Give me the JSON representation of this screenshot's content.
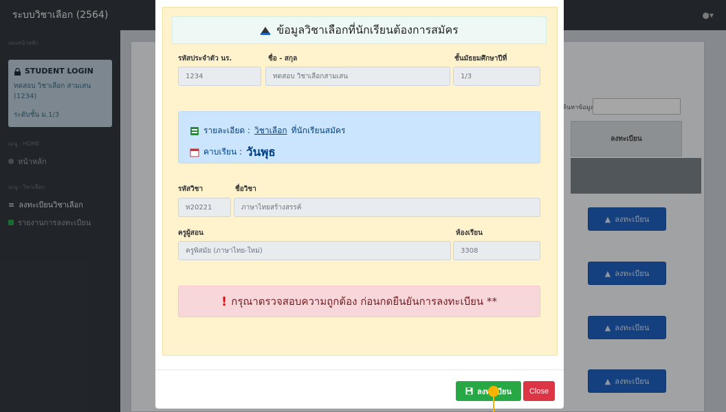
{
  "navbar": {
    "brand": "ระบบวิชาเลือก (2564)",
    "user_icon": "user-icon"
  },
  "sidebar": {
    "menu_head": "เมนหน้าหลัก",
    "login": {
      "title": "STUDENT LOGIN",
      "name": "ทดสอบ วิชาเลือก สามเสน (1234)",
      "level": "ระดับชั้น ม.1/3"
    },
    "section_home": "เมนู : HOME",
    "item_home": "หน้าหลัก",
    "section_subject": "เมนู : วิชาเลือก",
    "item_register": "ลงทะเบียนวิชาเลือก",
    "item_report": "รายงานการลงทะเบียน"
  },
  "background": {
    "search_label": "ค้นหาข้อมูล :",
    "column_header": "ลงทะเบียน",
    "register_buttons": [
      "ลงทะเบียน",
      "ลงทะเบียน",
      "ลงทะเบียน",
      "ลงทะเบียน"
    ]
  },
  "modal": {
    "title": "ข้อมูลวิชาเลือกที่นักเรียนต้องการสมัคร",
    "student_id_label": "รหัสประจำตัว นร.",
    "student_id": "1234",
    "name_label": "ชื่อ - สกุล",
    "name": "ทดสอบ วิชาเลือกสามเสน",
    "grade_label": "ชั้นมัธยมศึกษาปีที่",
    "grade": "1/3",
    "info_prefix": "รายละเอียด :",
    "info_link": "วิชาเลือก",
    "info_suffix": "ที่นักเรียนสมัคร",
    "period_prefix": "คาบเรียน :",
    "period_day": "วันพุธ",
    "subject_code_label": "รหัสวิชา",
    "subject_code": "ท20221",
    "subject_name_label": "ชื่อวิชา",
    "subject_name": "ภาษาไทยสร้างสรรค์",
    "teacher_label": "ครูผู้สอน",
    "teacher": "ครูพิสมัย (ภาษาไทย-ใหม่)",
    "room_label": "ห้องเรียน",
    "room": "3308",
    "warning": "กรุณาตรวจสอบความถูกต้อง ก่อนกดยืนยันการลงทะเบียน **",
    "save_label": "ลงทะเบียน",
    "close_label": "Close"
  },
  "colors": {
    "save": "#28a745",
    "close": "#dc3545",
    "info": "#cce5ff",
    "warn": "#f8d7da",
    "frame": "#fff3cd"
  }
}
